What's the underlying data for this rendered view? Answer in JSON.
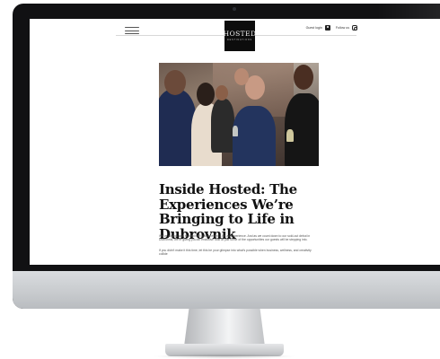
{
  "site": {
    "logo_word": "HOSTED",
    "logo_sub": "DESTINATIONS",
    "guest_login": "Guest login",
    "follow_us": "Follow us"
  },
  "article": {
    "title": "Inside Hosted: The Experiences We’re Bringing to Life in Dubrovnik",
    "intro": "We’ve always said Hosted isn’t just an event – it’s an experience. And as we count down to our sold-out debut in Dubrovnik, we’re giving you an exclusive look at just some of the opportunities our guests will be stepping into.",
    "body": "If you didn’t make it this time, let this be your glimpse into what’s possible when business, wellness, and creativity collide"
  },
  "icons": {
    "menu": "hamburger-icon",
    "user": "user-icon",
    "social": "instagram-icon"
  },
  "colors": {
    "bezel": "#111113",
    "logo_bg": "#0c0c0c",
    "text": "#111111",
    "suit_blue": "#23345e"
  }
}
